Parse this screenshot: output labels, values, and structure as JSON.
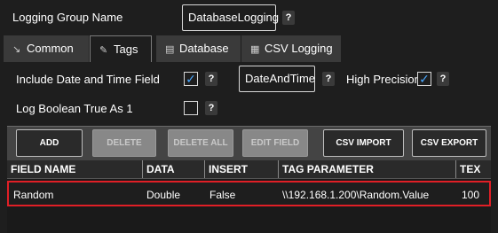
{
  "header": {
    "group_label": "Logging Group Name",
    "group_value": "DatabaseLogging",
    "help": "?"
  },
  "tabs": [
    {
      "label": "Common",
      "icon": "chart-icon",
      "glyph": "↘"
    },
    {
      "label": "Tags",
      "icon": "tag-icon",
      "glyph": "✎"
    },
    {
      "label": "Database",
      "icon": "database-icon",
      "glyph": "▤"
    },
    {
      "label": "CSV Logging",
      "icon": "file-icon",
      "glyph": "▦"
    }
  ],
  "options": {
    "include_datetime_label": "Include Date and Time Field",
    "include_datetime_checked": "✓",
    "datetime_field_value": "DateAndTime",
    "high_precision_label": "High Precision",
    "high_precision_checked": "✓",
    "log_bool_label": "Log Boolean True As 1",
    "log_bool_checked": ""
  },
  "toolbar": {
    "add": "ADD",
    "delete": "DELETE",
    "delete_all": "DELETE ALL",
    "edit_field": "EDIT FIELD",
    "csv_import": "CSV IMPORT",
    "csv_export": "CSV EXPORT"
  },
  "table": {
    "columns": [
      "FIELD NAME",
      "DATA TYPE",
      "INSERT ONLY",
      "TAG PARAMETER",
      "TEX"
    ],
    "rows": [
      [
        "Random",
        "Double",
        "False",
        "\\\\192.168.1.200\\Random.Value",
        "100"
      ]
    ]
  },
  "colors": {
    "accent": "#4aa8ff",
    "selection_border": "#e01f26",
    "background": "#1e1e1e"
  }
}
